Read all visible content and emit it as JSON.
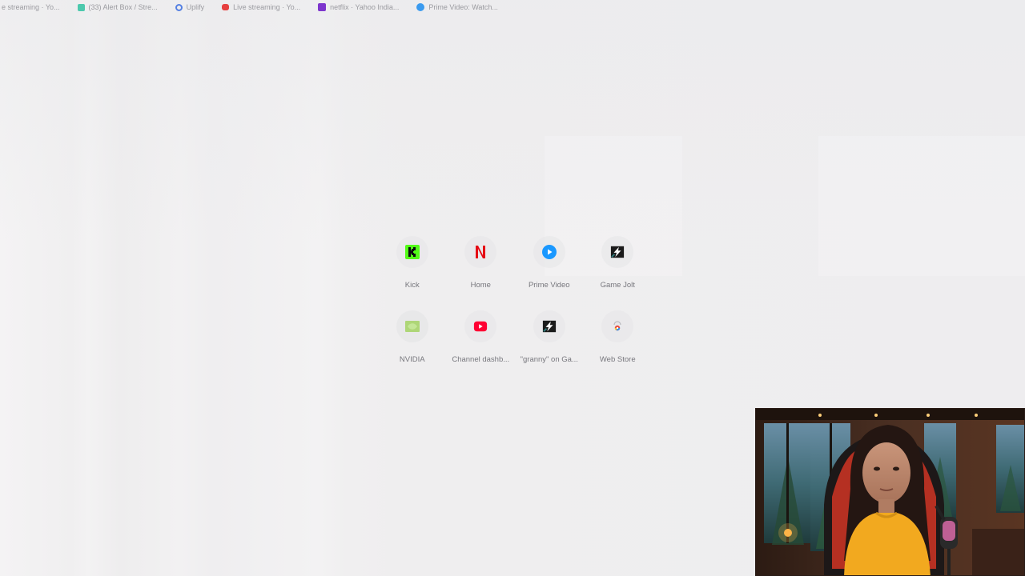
{
  "bookmarks": [
    {
      "label": "e streaming · Yo...",
      "icon": "youtube-icon",
      "color": "#d6d6d8"
    },
    {
      "label": "(33) Alert Box / Stre...",
      "icon": "streamlabs-icon",
      "color": "#31c3a2"
    },
    {
      "label": "Uplify",
      "icon": "uplify-icon",
      "color": "#3b6fe0"
    },
    {
      "label": "Live streaming · Yo...",
      "icon": "youtube-icon",
      "color": "#e52222"
    },
    {
      "label": "netflix · Yahoo India...",
      "icon": "yahoo-icon",
      "color": "#6a16c8"
    },
    {
      "label": "Prime Video: Watch...",
      "icon": "prime-video-icon",
      "color": "#1b8cf0"
    }
  ],
  "shortcuts": [
    {
      "label": "Kick",
      "icon": "kick-icon"
    },
    {
      "label": "Home",
      "icon": "netflix-icon"
    },
    {
      "label": "Prime Video",
      "icon": "prime-video-icon"
    },
    {
      "label": "Game Jolt",
      "icon": "game-jolt-icon"
    },
    {
      "label": "NVIDIA",
      "icon": "nvidia-icon"
    },
    {
      "label": "Channel dashb...",
      "icon": "youtube-icon"
    },
    {
      "label": "\"granny\" on Ga...",
      "icon": "game-jolt-icon"
    },
    {
      "label": "Web Store",
      "icon": "web-store-icon"
    }
  ],
  "colors": {
    "kick": "#53fc18",
    "netflix": "#e50914",
    "prime": "#1a98ff",
    "youtube": "#ff0033",
    "nvidia": "#76b900"
  },
  "webcam": {
    "icon": "webcam-overlay"
  }
}
